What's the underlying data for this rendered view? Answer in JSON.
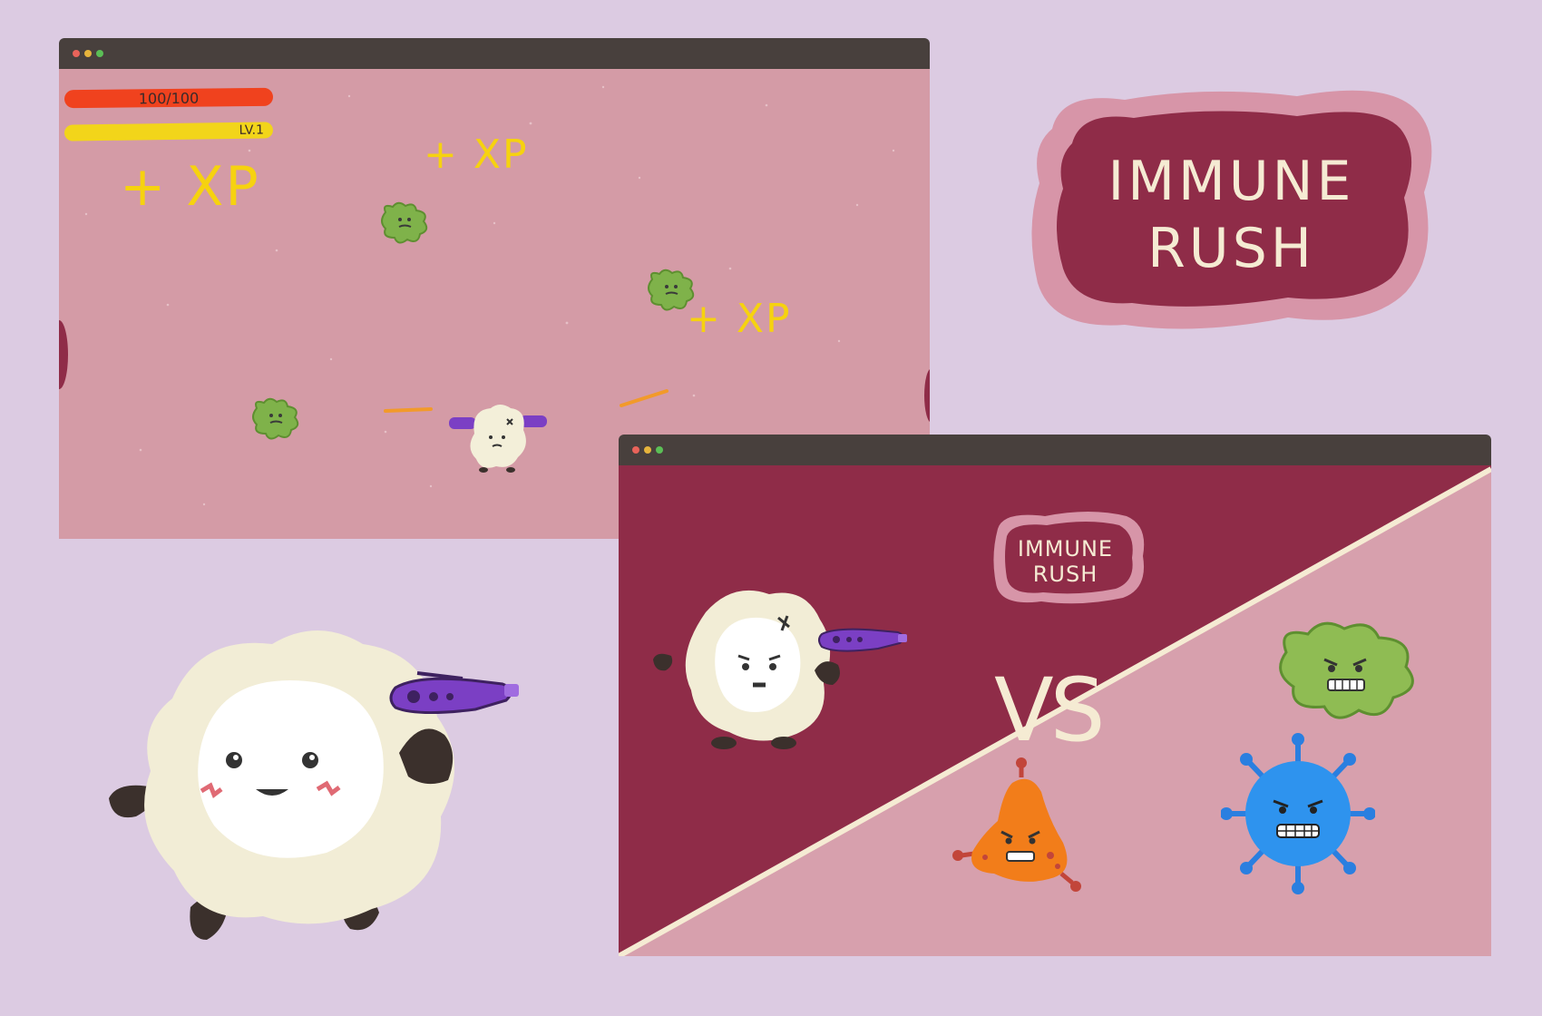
{
  "game": {
    "title_line1": "IMMUNE",
    "title_line2": "RUSH"
  },
  "hud": {
    "health_text": "100/100",
    "level_text": "LV.1"
  },
  "xp_popups": [
    "+ XP",
    "+ XP",
    "+ XP"
  ],
  "versus_screen": {
    "vs_text": "VS",
    "logo_line1": "IMMUNE",
    "logo_line2": "RUSH"
  },
  "colors": {
    "background": "#dccbe2",
    "field_pink": "#d49ba6",
    "maroon": "#8f2c48",
    "cream": "#f5ebd3",
    "hp_red": "#f0421e",
    "xp_yellow": "#f2d51a",
    "blaster_purple": "#7b3fc4"
  },
  "icons": [
    "white-blood-cell-icon",
    "blaster-icon",
    "green-germ-icon",
    "orange-bacteria-icon",
    "blue-virus-icon"
  ]
}
